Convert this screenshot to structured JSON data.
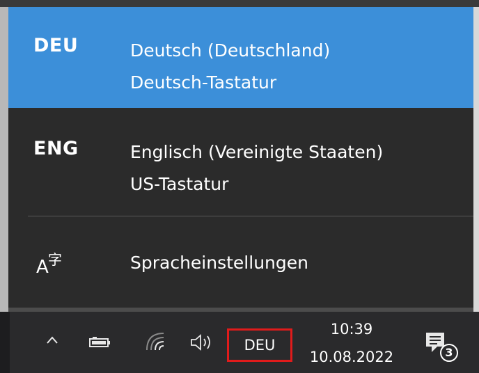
{
  "flyout": {
    "languages": [
      {
        "code": "DEU",
        "name": "Deutsch (Deutschland)",
        "keyboard": "Deutsch-Tastatur",
        "selected": true
      },
      {
        "code": "ENG",
        "name": "Englisch (Vereinigte Staaten)",
        "keyboard": "US-Tastatur",
        "selected": false
      }
    ],
    "settings": {
      "label": "Spracheinstellungen",
      "icon": "language-settings-icon",
      "glyph_latin": "A",
      "glyph_cjk": "字"
    }
  },
  "taskbar": {
    "icons": [
      "chevron-up-icon",
      "battery-icon",
      "wifi-icon",
      "volume-icon"
    ],
    "language_indicator": "DEU",
    "time": "10:39",
    "date": "10.08.2022",
    "notification_count": "3"
  },
  "colors": {
    "selected": "#3c8fd9",
    "flyout_bg": "#2b2b2b",
    "taskbar_bg": "#2a2a2c",
    "highlight_border": "#e01b1b"
  }
}
